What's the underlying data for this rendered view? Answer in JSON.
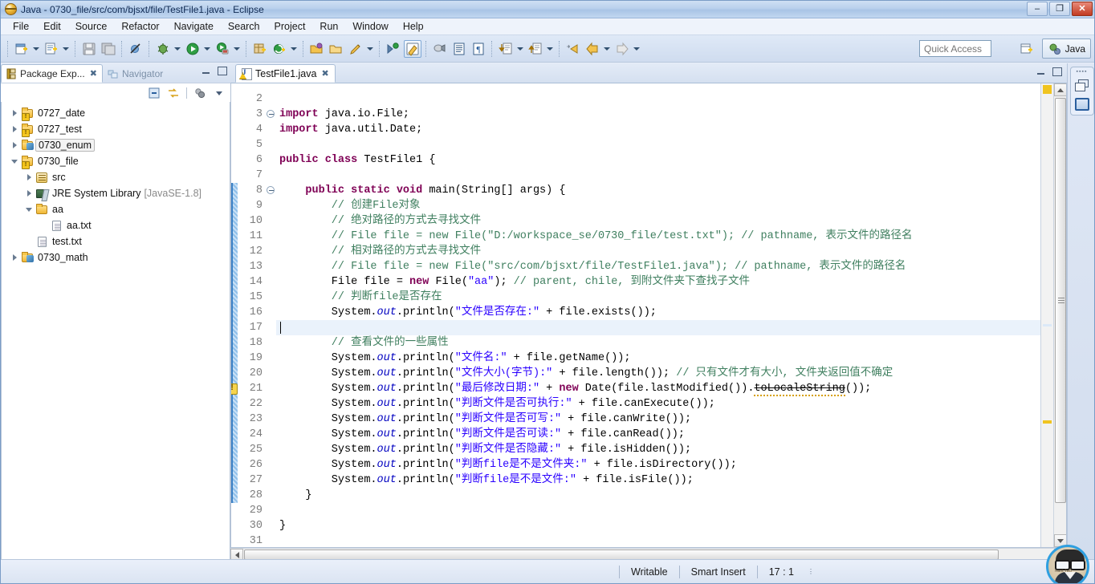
{
  "window": {
    "title": "Java - 0730_file/src/com/bjsxt/file/TestFile1.java - Eclipse",
    "minimize_label": "–",
    "restore_label": "❐",
    "close_label": "✕"
  },
  "menubar": {
    "items": [
      "File",
      "Edit",
      "Source",
      "Refactor",
      "Navigate",
      "Search",
      "Project",
      "Run",
      "Window",
      "Help"
    ]
  },
  "toolbar": {
    "quick_access_placeholder": "Quick Access",
    "quick_access_value": "",
    "perspective_open_label": "",
    "perspective_active_label": "Java",
    "icons": [
      "new-wizard-icon",
      "new-wizard-dropdown-icon",
      "new-java-class-icon",
      "new-java-class-dropdown-icon",
      "save-icon",
      "save-all-icon",
      "skip-all-breakpoints-icon",
      "debug-icon",
      "debug-dropdown-icon",
      "run-icon",
      "run-dropdown-icon",
      "run-external-tools-icon",
      "external-tools-dropdown-icon",
      "new-java-package-icon",
      "new-java-project-icon",
      "new-project-dropdown-icon",
      "open-type-icon",
      "open-task-icon",
      "search-icon",
      "search-dropdown-icon",
      "toggle-mark-occurrences-icon",
      "pin-editor-icon",
      "link-with-editor-icon",
      "show-whitespace-icon",
      "show-source-quickview-icon",
      "next-annotation-icon",
      "next-annotation-dropdown-icon",
      "previous-annotation-icon",
      "previous-annotation-dropdown-icon",
      "back-icon",
      "back-dropdown-icon",
      "forward-icon",
      "forward-dropdown-icon"
    ]
  },
  "left_pane": {
    "tabs": [
      {
        "label": "Package Exp...",
        "active": true,
        "closable": true,
        "icon": "package-explorer-icon"
      },
      {
        "label": "Navigator",
        "active": false,
        "closable": false,
        "icon": "navigator-icon"
      }
    ],
    "view_toolbar": [
      "collapse-all-icon",
      "link-with-editor-icon",
      "focus-on-active-task-icon",
      "view-menu-icon"
    ],
    "tree": [
      {
        "indent": 0,
        "twisty": "closed",
        "icon": "java-project-warning-icon",
        "label": "0727_date",
        "sub": "",
        "selected": false
      },
      {
        "indent": 0,
        "twisty": "closed",
        "icon": "java-project-warning-icon",
        "label": "0727_test",
        "sub": "",
        "selected": false
      },
      {
        "indent": 0,
        "twisty": "closed",
        "icon": "java-project-icon",
        "label": "0730_enum",
        "sub": "",
        "selected": true
      },
      {
        "indent": 0,
        "twisty": "open",
        "icon": "java-project-warning-icon",
        "label": "0730_file",
        "sub": "",
        "selected": false
      },
      {
        "indent": 1,
        "twisty": "closed",
        "icon": "source-folder-icon",
        "label": "src",
        "sub": "",
        "selected": false
      },
      {
        "indent": 1,
        "twisty": "closed",
        "icon": "jre-library-icon",
        "label": "JRE System Library",
        "sub": "[JavaSE-1.8]",
        "selected": false
      },
      {
        "indent": 1,
        "twisty": "open",
        "icon": "folder-icon",
        "label": "aa",
        "sub": "",
        "selected": false
      },
      {
        "indent": 2,
        "twisty": "none",
        "icon": "text-file-icon",
        "label": "aa.txt",
        "sub": "",
        "selected": false
      },
      {
        "indent": 1,
        "twisty": "none",
        "icon": "text-file-icon",
        "label": "test.txt",
        "sub": "",
        "selected": false
      },
      {
        "indent": 0,
        "twisty": "closed",
        "icon": "java-project-icon",
        "label": "0730_math",
        "sub": "",
        "selected": false
      }
    ]
  },
  "editor": {
    "tab": {
      "label": "TestFile1.java",
      "icon": "java-file-warning-icon",
      "close_label": "✖",
      "active": true
    },
    "controls": [
      "minimize-icon",
      "maximize-icon"
    ],
    "first_visible_line": 2,
    "cursor_line": 17,
    "warning_line": 21,
    "changed_range": [
      8,
      28
    ],
    "fold_lines": [
      3,
      8
    ],
    "lines": [
      {
        "n": 2,
        "tokens": []
      },
      {
        "n": 3,
        "tokens": [
          {
            "t": "kw",
            "v": "import"
          },
          {
            "t": "plain",
            "v": " java.io.File;"
          }
        ]
      },
      {
        "n": 4,
        "tokens": [
          {
            "t": "kw",
            "v": "import"
          },
          {
            "t": "plain",
            "v": " java.util.Date;"
          }
        ]
      },
      {
        "n": 5,
        "tokens": []
      },
      {
        "n": 6,
        "tokens": [
          {
            "t": "kw",
            "v": "public class"
          },
          {
            "t": "plain",
            "v": " TestFile1 {"
          }
        ]
      },
      {
        "n": 7,
        "tokens": []
      },
      {
        "n": 8,
        "tokens": [
          {
            "t": "plain",
            "v": "    "
          },
          {
            "t": "kw",
            "v": "public static void"
          },
          {
            "t": "plain",
            "v": " main(String[] args) {"
          }
        ]
      },
      {
        "n": 9,
        "tokens": [
          {
            "t": "cmt",
            "v": "        // 创建File对象"
          }
        ]
      },
      {
        "n": 10,
        "tokens": [
          {
            "t": "cmt",
            "v": "        // 绝对路径的方式去寻找文件"
          }
        ]
      },
      {
        "n": 11,
        "tokens": [
          {
            "t": "cmt",
            "v": "        // File file = new File(\"D:/workspace_se/0730_file/test.txt\"); // pathname, 表示文件的路径名"
          }
        ]
      },
      {
        "n": 12,
        "tokens": [
          {
            "t": "cmt",
            "v": "        // 相对路径的方式去寻找文件"
          }
        ]
      },
      {
        "n": 13,
        "tokens": [
          {
            "t": "cmt",
            "v": "        // File file = new File(\"src/com/bjsxt/file/TestFile1.java\"); // pathname, 表示文件的路径名"
          }
        ]
      },
      {
        "n": 14,
        "tokens": [
          {
            "t": "plain",
            "v": "        File file = "
          },
          {
            "t": "kw",
            "v": "new"
          },
          {
            "t": "plain",
            "v": " File("
          },
          {
            "t": "str",
            "v": "\"aa\""
          },
          {
            "t": "plain",
            "v": "); "
          },
          {
            "t": "cmt",
            "v": "// parent, chile, 到附文件夹下查找子文件"
          }
        ]
      },
      {
        "n": 15,
        "tokens": [
          {
            "t": "cmt",
            "v": "        // 判断file是否存在"
          }
        ]
      },
      {
        "n": 16,
        "tokens": [
          {
            "t": "plain",
            "v": "        System."
          },
          {
            "t": "stat",
            "v": "out"
          },
          {
            "t": "plain",
            "v": ".println("
          },
          {
            "t": "str",
            "v": "\"文件是否存在:\""
          },
          {
            "t": "plain",
            "v": " + file.exists());"
          }
        ]
      },
      {
        "n": 17,
        "tokens": []
      },
      {
        "n": 18,
        "tokens": [
          {
            "t": "cmt",
            "v": "        // 查看文件的一些属性"
          }
        ]
      },
      {
        "n": 19,
        "tokens": [
          {
            "t": "plain",
            "v": "        System."
          },
          {
            "t": "stat",
            "v": "out"
          },
          {
            "t": "plain",
            "v": ".println("
          },
          {
            "t": "str",
            "v": "\"文件名:\""
          },
          {
            "t": "plain",
            "v": " + file.getName());"
          }
        ]
      },
      {
        "n": 20,
        "tokens": [
          {
            "t": "plain",
            "v": "        System."
          },
          {
            "t": "stat",
            "v": "out"
          },
          {
            "t": "plain",
            "v": ".println("
          },
          {
            "t": "str",
            "v": "\"文件大小(字节):\""
          },
          {
            "t": "plain",
            "v": " + file.length()); "
          },
          {
            "t": "cmt",
            "v": "// 只有文件才有大小, 文件夹返回值不确定"
          }
        ]
      },
      {
        "n": 21,
        "tokens": [
          {
            "t": "plain",
            "v": "        System."
          },
          {
            "t": "stat",
            "v": "out"
          },
          {
            "t": "plain",
            "v": ".println("
          },
          {
            "t": "str",
            "v": "\"最后修改日期:\""
          },
          {
            "t": "plain",
            "v": " + "
          },
          {
            "t": "kw",
            "v": "new"
          },
          {
            "t": "plain",
            "v": " Date(file.lastModified())."
          },
          {
            "t": "dep",
            "v": "toLocaleString"
          },
          {
            "t": "plain",
            "v": "());"
          }
        ]
      },
      {
        "n": 22,
        "tokens": [
          {
            "t": "plain",
            "v": "        System."
          },
          {
            "t": "stat",
            "v": "out"
          },
          {
            "t": "plain",
            "v": ".println("
          },
          {
            "t": "str",
            "v": "\"判断文件是否可执行:\""
          },
          {
            "t": "plain",
            "v": " + file.canExecute());"
          }
        ]
      },
      {
        "n": 23,
        "tokens": [
          {
            "t": "plain",
            "v": "        System."
          },
          {
            "t": "stat",
            "v": "out"
          },
          {
            "t": "plain",
            "v": ".println("
          },
          {
            "t": "str",
            "v": "\"判断文件是否可写:\""
          },
          {
            "t": "plain",
            "v": " + file.canWrite());"
          }
        ]
      },
      {
        "n": 24,
        "tokens": [
          {
            "t": "plain",
            "v": "        System."
          },
          {
            "t": "stat",
            "v": "out"
          },
          {
            "t": "plain",
            "v": ".println("
          },
          {
            "t": "str",
            "v": "\"判断文件是否可读:\""
          },
          {
            "t": "plain",
            "v": " + file.canRead());"
          }
        ]
      },
      {
        "n": 25,
        "tokens": [
          {
            "t": "plain",
            "v": "        System."
          },
          {
            "t": "stat",
            "v": "out"
          },
          {
            "t": "plain",
            "v": ".println("
          },
          {
            "t": "str",
            "v": "\"判断文件是否隐藏:\""
          },
          {
            "t": "plain",
            "v": " + file.isHidden());"
          }
        ]
      },
      {
        "n": 26,
        "tokens": [
          {
            "t": "plain",
            "v": "        System."
          },
          {
            "t": "stat",
            "v": "out"
          },
          {
            "t": "plain",
            "v": ".println("
          },
          {
            "t": "str",
            "v": "\"判断file是不是文件夹:\""
          },
          {
            "t": "plain",
            "v": " + file.isDirectory());"
          }
        ]
      },
      {
        "n": 27,
        "tokens": [
          {
            "t": "plain",
            "v": "        System."
          },
          {
            "t": "stat",
            "v": "out"
          },
          {
            "t": "plain",
            "v": ".println("
          },
          {
            "t": "str",
            "v": "\"判断file是不是文件:\""
          },
          {
            "t": "plain",
            "v": " + file.isFile());"
          }
        ]
      },
      {
        "n": 28,
        "tokens": [
          {
            "t": "plain",
            "v": "    }"
          }
        ]
      },
      {
        "n": 29,
        "tokens": []
      },
      {
        "n": 30,
        "tokens": [
          {
            "t": "plain",
            "v": "}"
          }
        ]
      },
      {
        "n": 31,
        "tokens": []
      }
    ]
  },
  "right_bar": {
    "items": [
      "restore-icon",
      "console-view-icon"
    ]
  },
  "statusbar": {
    "writable": "Writable",
    "insert_mode": "Smart Insert",
    "position": "17 : 1"
  },
  "colors": {
    "keyword": "#7F0055",
    "string": "#2A00FF",
    "comment": "#3F7F5F",
    "static_field": "#0000C0",
    "current_line": "#EAF2FB",
    "selection_blue": "#3A7FC4",
    "warning_yellow": "#F7D44C",
    "titlebar_blue": "#B9D0EC",
    "avatar_ring": "#2E9FE0"
  }
}
